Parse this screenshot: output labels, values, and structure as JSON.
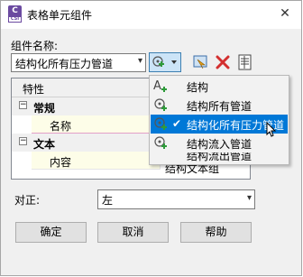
{
  "window": {
    "title": "表格单元组件",
    "app_badge": "C",
    "app_badge_sub": "CSI"
  },
  "component": {
    "label": "组件名称:",
    "value": "结构化所有压力管道"
  },
  "properties": {
    "header": "特性",
    "groups": [
      {
        "name": "常规",
        "props": [
          {
            "name": "名称"
          }
        ]
      },
      {
        "name": "文本",
        "props": [
          {
            "name": "内容",
            "value": "结构文本组"
          }
        ]
      }
    ]
  },
  "dropdown_menu": {
    "items": [
      {
        "label": "结构",
        "icon": "text-add-icon",
        "selected": false
      },
      {
        "label": "结构所有管道",
        "icon": "structure-add-icon",
        "selected": false
      },
      {
        "label": "结构化所有压力管道",
        "icon": "structure-add-icon",
        "selected": true
      },
      {
        "label": "结构流入管道",
        "icon": "structure-add-icon",
        "selected": false
      },
      {
        "label": "结构流出管道",
        "icon": "structure-add-icon",
        "selected": false
      }
    ]
  },
  "alignment": {
    "label": "对正:",
    "value": "左"
  },
  "buttons": {
    "ok": "确定",
    "cancel": "取消",
    "help": "帮助"
  },
  "colors": {
    "accent": "#0078d7",
    "delete_red": "#d32f2f",
    "add_green": "#2e9b3a"
  }
}
